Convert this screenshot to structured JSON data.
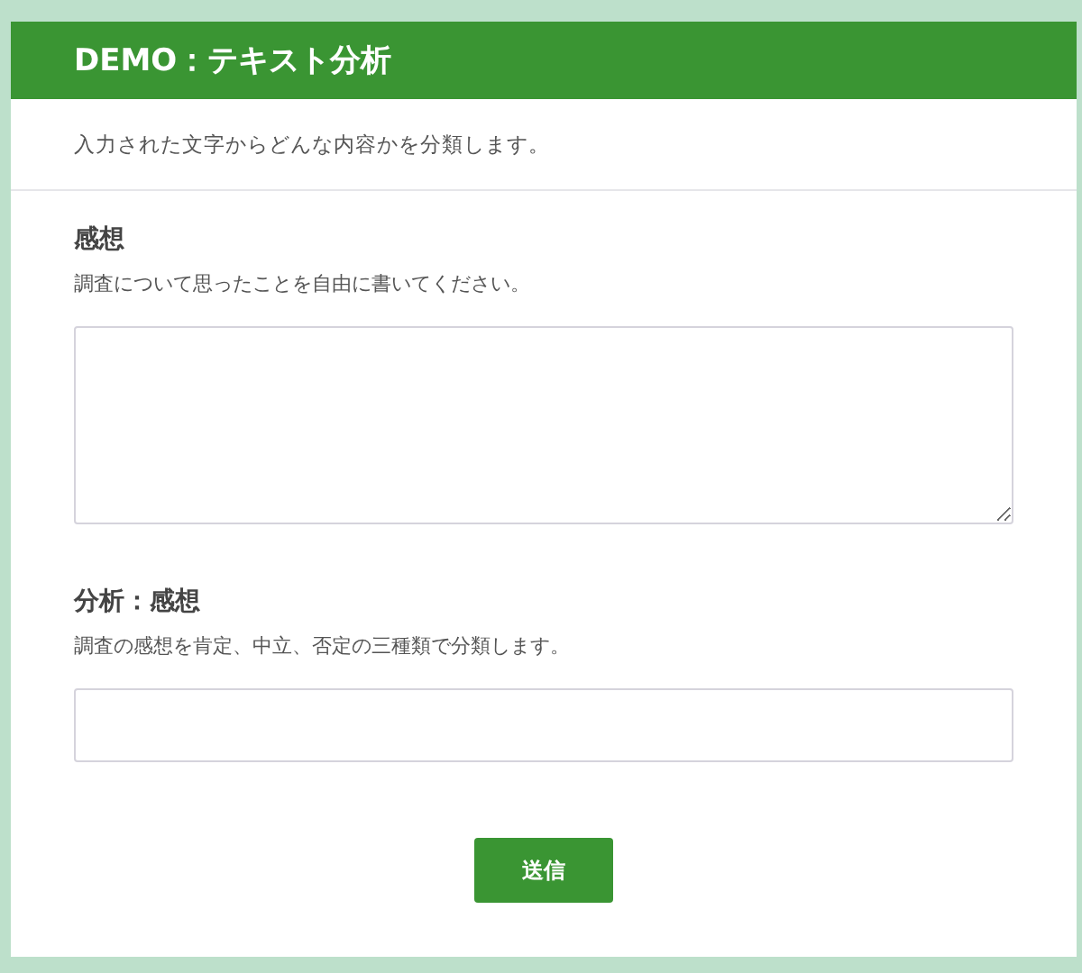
{
  "header": {
    "title": "DEMO：テキスト分析"
  },
  "description": "入力された文字からどんな内容かを分類します。",
  "fields": [
    {
      "kind": "textarea",
      "label": "感想",
      "help": "調査について思ったことを自由に書いてください。"
    },
    {
      "kind": "input",
      "label": "分析：感想",
      "help": "調査の感想を肯定、中立、否定の三種類で分類します。"
    }
  ],
  "submit": "送信"
}
